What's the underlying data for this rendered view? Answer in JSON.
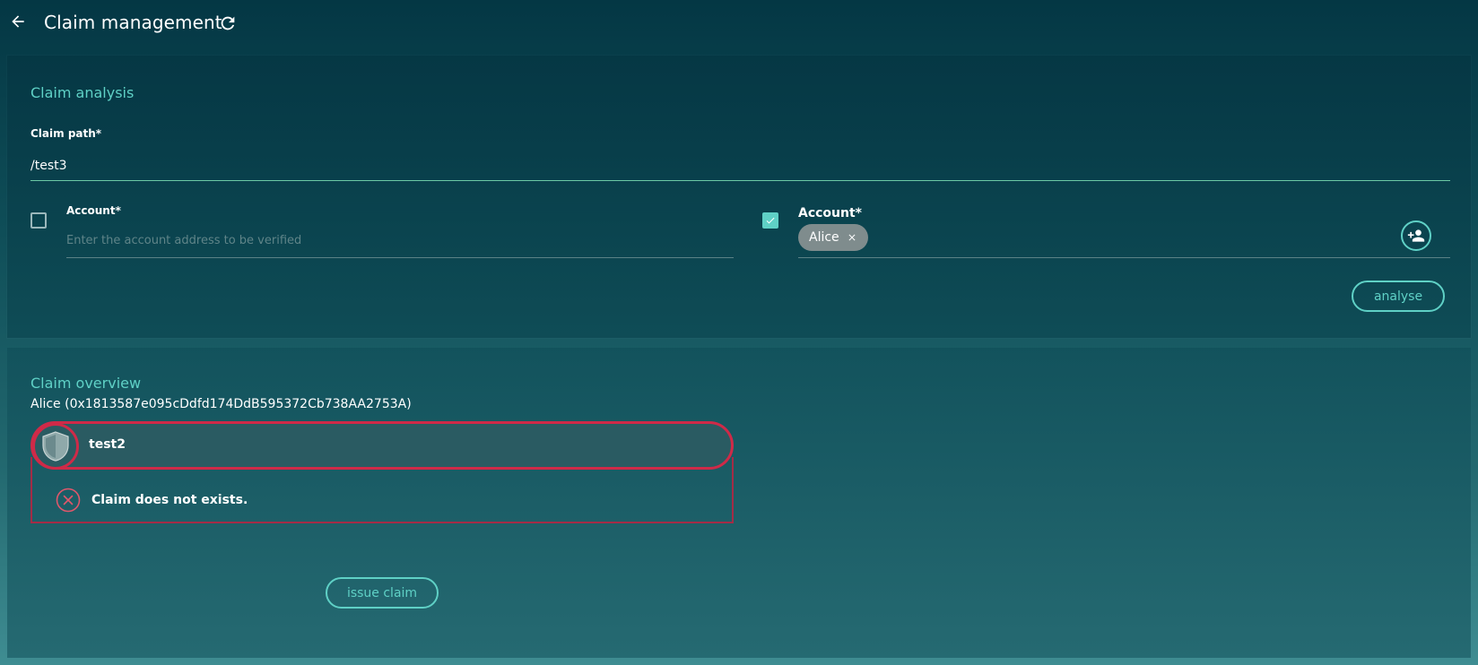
{
  "header": {
    "title": "Claim management",
    "back_icon": "arrow-left-icon",
    "refresh_icon": "refresh-icon"
  },
  "analysis": {
    "title": "Claim analysis",
    "path_label": "Claim path*",
    "path_value": "/test3",
    "left_account": {
      "checked": false,
      "label": "Account*",
      "placeholder": "Enter the account address to be verified",
      "value": ""
    },
    "right_account": {
      "checked": true,
      "label": "Account*",
      "chip": "Alice",
      "add_icon": "add-person-icon"
    },
    "analyse_label": "analyse"
  },
  "overview": {
    "title": "Claim overview",
    "account_line": "Alice (0x1813587e095cDdfd174DdB595372Cb738AA2753A)",
    "claims": [
      {
        "name": "test2",
        "icon": "shield-icon",
        "status_icon": "error-x-icon",
        "status_text": "Claim does not exists."
      }
    ],
    "issue_label": "issue claim"
  },
  "colors": {
    "accent": "#5fd1c6",
    "error": "#cf2a48",
    "chip": "#7f8c8d"
  }
}
